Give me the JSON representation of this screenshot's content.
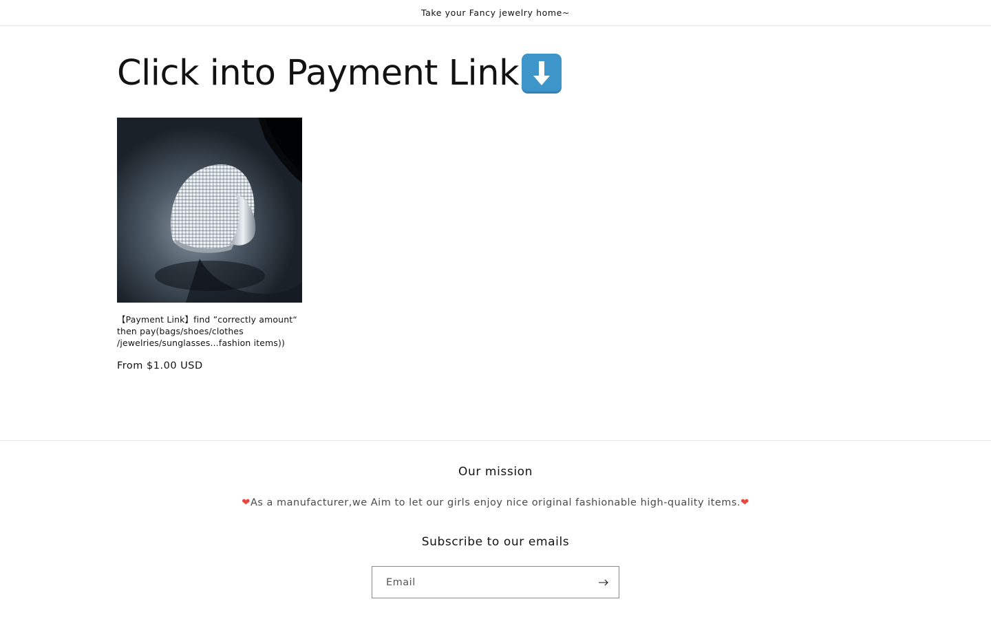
{
  "announcement": {
    "text": "Take your Fancy jewelry home~"
  },
  "collection": {
    "title": "Click into Payment Link",
    "title_icon": "down-arrow-emoji-icon",
    "products": [
      {
        "title": "【Payment Link】find ”correctly amount“ then pay(bags/shoes/clothes /jewelries/sunglasses...fashion items))",
        "price": "From $1.00 USD",
        "image": "silver-pave-ring-photo"
      }
    ]
  },
  "footer": {
    "mission_heading": "Our mission",
    "mission_text": "As a manufacturer,we Aim to let our girls enjoy nice original fashionable high-quality items.",
    "mission_icon": "heart-icon",
    "subscribe_heading": "Subscribe to our emails",
    "email_placeholder": "Email",
    "submit_icon": "arrow-right-icon"
  },
  "colors": {
    "text": "#121212",
    "heart": "#e8453c",
    "arrow_emoji_bg": "#3e95c9"
  }
}
